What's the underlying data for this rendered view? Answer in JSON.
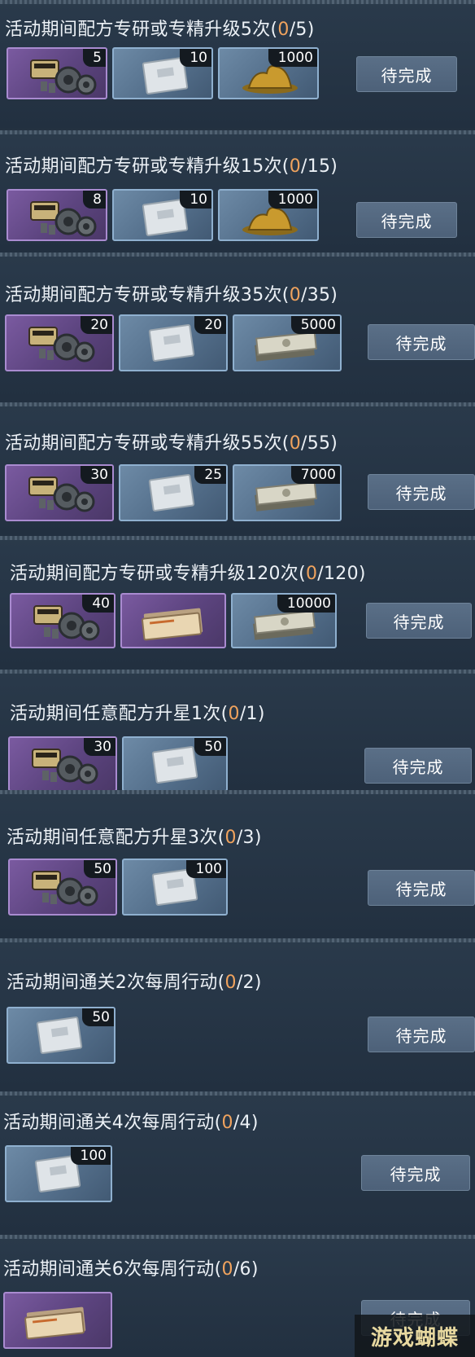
{
  "tasks": [
    {
      "prefix": "活动期间配方专研或专精升级5次",
      "current": "0",
      "total": "/5)",
      "rewards": [
        {
          "type": "gears",
          "qty": "5"
        },
        {
          "type": "pack",
          "qty": "10"
        },
        {
          "type": "gold",
          "qty": "1000"
        }
      ],
      "button": "待完成"
    },
    {
      "prefix": "活动期间配方专研或专精升级15次",
      "current": "0",
      "total": "/15)",
      "rewards": [
        {
          "type": "gears",
          "qty": "8"
        },
        {
          "type": "pack",
          "qty": "10"
        },
        {
          "type": "gold",
          "qty": "1000"
        }
      ],
      "button": "待完成"
    },
    {
      "prefix": "活动期间配方专研或专精升级35次",
      "current": "0",
      "total": "/35)",
      "rewards": [
        {
          "type": "gears",
          "qty": "20"
        },
        {
          "type": "pack",
          "qty": "20"
        },
        {
          "type": "cash",
          "qty": "5000"
        }
      ],
      "button": "待完成"
    },
    {
      "prefix": "活动期间配方专研或专精升级55次",
      "current": "0",
      "total": "/55)",
      "rewards": [
        {
          "type": "gears",
          "qty": "30"
        },
        {
          "type": "pack",
          "qty": "25"
        },
        {
          "type": "cash",
          "qty": "7000"
        }
      ],
      "button": "待完成"
    },
    {
      "prefix": "活动期间配方专研或专精升级120次",
      "current": "0",
      "total": "/120)",
      "rewards": [
        {
          "type": "gears",
          "qty": "40"
        },
        {
          "type": "folder",
          "qty": ""
        },
        {
          "type": "cash",
          "qty": "10000"
        }
      ],
      "button": "待完成"
    },
    {
      "prefix": "活动期间任意配方升星1次",
      "current": "0",
      "total": "/1)",
      "rewards": [
        {
          "type": "gears",
          "qty": "30"
        },
        {
          "type": "pack",
          "qty": "50"
        }
      ],
      "button": "待完成"
    },
    {
      "prefix": "活动期间任意配方升星3次",
      "current": "0",
      "total": "/3)",
      "rewards": [
        {
          "type": "gears",
          "qty": "50"
        },
        {
          "type": "pack",
          "qty": "100"
        }
      ],
      "button": "待完成"
    },
    {
      "prefix": "活动期间通关2次每周行动",
      "current": "0",
      "total": "/2)",
      "rewards": [
        {
          "type": "pack",
          "qty": "50"
        }
      ],
      "button": "待完成"
    },
    {
      "prefix": "活动期间通关4次每周行动",
      "current": "0",
      "total": "/4)",
      "rewards": [
        {
          "type": "pack",
          "qty": "100"
        }
      ],
      "button": "待完成"
    },
    {
      "prefix": "活动期间通关6次每周行动",
      "current": "0",
      "total": "/6)",
      "rewards": [
        {
          "type": "folder",
          "qty": ""
        }
      ],
      "button": "待完成"
    }
  ],
  "open_paren": "(",
  "watermark": "游戏蝴蝶",
  "colors": {
    "progress_current": "#f0a35e",
    "purple_frame": "#a98bd0",
    "blue_frame": "#8fb0cf"
  }
}
